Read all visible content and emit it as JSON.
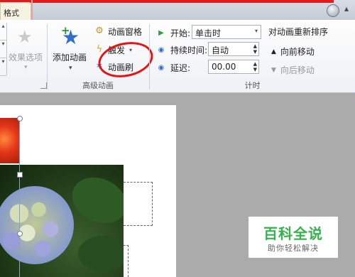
{
  "tabs": {
    "format_label": "格式"
  },
  "groups": {
    "effect_options": {
      "label": "效果选项",
      "icon": "star-icon"
    },
    "advanced": {
      "label": "高级动画",
      "add_animation": "添加动画",
      "animation_pane": "动画窗格",
      "trigger": "触发",
      "animation_painter": "动画刷"
    },
    "timing": {
      "label": "计时",
      "start_label": "开始:",
      "start_value": "单击时",
      "duration_label": "持续时间:",
      "duration_value": "自动",
      "delay_label": "延迟:",
      "delay_value": "00.00",
      "reorder_title": "对动画重新排序",
      "move_earlier": "向前移动",
      "move_later": "向后移动"
    }
  },
  "watermark": {
    "title": "百科全说",
    "subtitle": "助你轻松解决"
  },
  "colors": {
    "annotation_red": "#e31414",
    "watermark_green": "#33b34a",
    "accent_blue": "#2f6fc8"
  }
}
